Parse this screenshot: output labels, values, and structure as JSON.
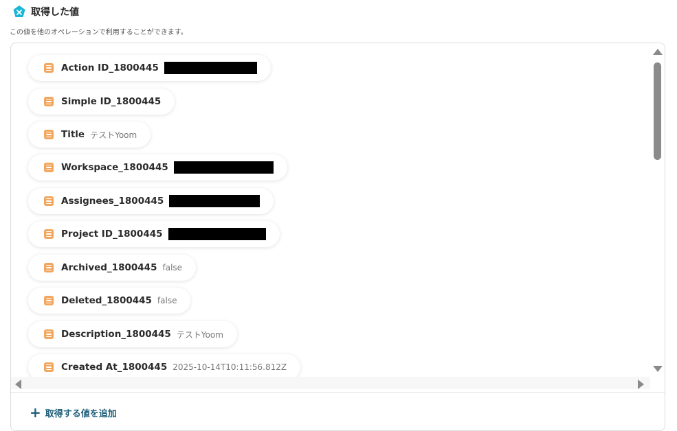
{
  "header": {
    "title": "取得した値",
    "subtitle": "この値を他のオペレーションで利用することができます。",
    "accent_color": "#1ab6d6"
  },
  "items": [
    {
      "name": "Action ID_1800445",
      "value": "",
      "redacted": true
    },
    {
      "name": "Simple ID_1800445",
      "value": "",
      "redacted": false
    },
    {
      "name": "Title",
      "value": "テストYoom",
      "redacted": false
    },
    {
      "name": "Workspace_1800445",
      "value": "",
      "redacted": true
    },
    {
      "name": "Assignees_1800445",
      "value": "",
      "redacted": true
    },
    {
      "name": "Project ID_1800445",
      "value": "",
      "redacted": true
    },
    {
      "name": "Archived_1800445",
      "value": "false",
      "redacted": false
    },
    {
      "name": "Deleted_1800445",
      "value": "false",
      "redacted": false
    },
    {
      "name": "Description_1800445",
      "value": "テストYoom",
      "redacted": false
    },
    {
      "name": "Created At_1800445",
      "value": "2025-10-14T10:11:56.812Z",
      "redacted": false
    }
  ],
  "item_icon": "text-field-icon",
  "item_icon_color": "#f3a65d",
  "add_button": {
    "icon": "plus-icon",
    "label": "取得する値を追加",
    "color": "#1f5f7a"
  }
}
